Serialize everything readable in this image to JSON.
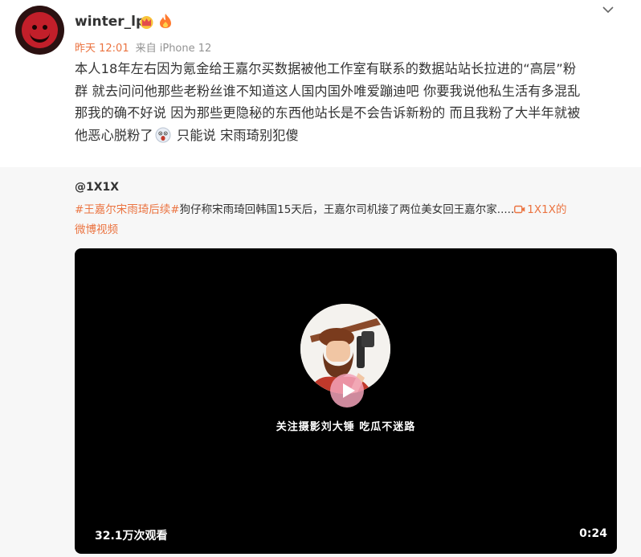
{
  "post": {
    "username": "winter_lp",
    "time": "昨天 12:01",
    "source": "来自 iPhone 12",
    "content_lines": [
      "本人18年左右因为氪金给王嘉尔买数据被他工作室有联系的数据站站长拉进的“高层”粉",
      "群 就去问问他那些老粉丝谁不知道这人国内国外唯爱蹦迪吧 你要我说他私生活有多混乱",
      "那我的确不好说 因为那些更隐秘的东西他站长是不会告诉新粉的 而且我粉了大半年就被"
    ],
    "content_last_before_emoji": "他恶心脱粉了",
    "content_last_after_emoji": " 只能说 宋雨琦别犯傻"
  },
  "repost": {
    "author": "@1X1X",
    "topic": "#王嘉尔宋雨琦后续#",
    "text": "狗仔称宋雨琦回韩国15天后，王嘉尔司机接了两位美女回王嘉尔家.....",
    "video_link_line1": "1X1X的",
    "video_link_line2": "微博视频"
  },
  "video": {
    "caption": "关注摄影刘大锤  吃瓜不迷路",
    "views": "32.1万次观看",
    "duration": "0:24"
  },
  "colors": {
    "accent": "#eb7340",
    "repost_bg": "#f7f7f7",
    "video_bg": "#000000"
  },
  "icons": [
    "chevron-down-icon",
    "crown-badge-icon",
    "fire-badge-icon",
    "shocked-emoji-icon",
    "video-link-icon",
    "play-icon"
  ]
}
